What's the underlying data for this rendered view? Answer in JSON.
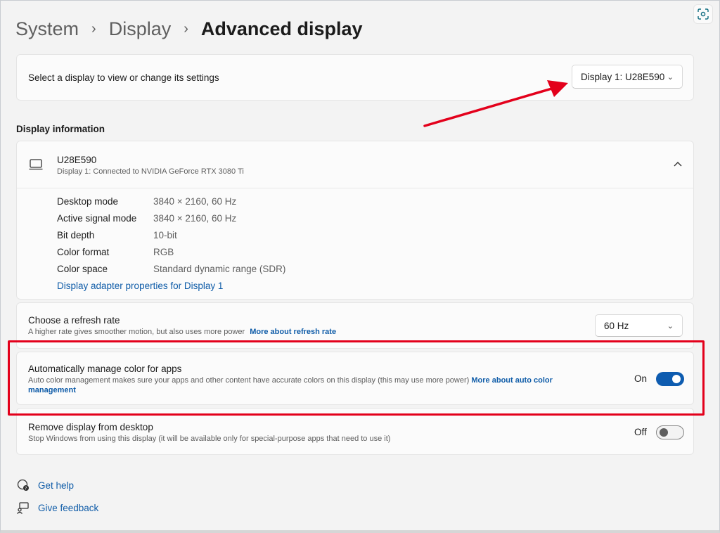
{
  "breadcrumb": {
    "items": [
      "System",
      "Display"
    ],
    "current": "Advanced display",
    "separator": "›"
  },
  "display_select": {
    "label": "Select a display to view or change its settings",
    "value": "Display 1: U28E590"
  },
  "display_information": {
    "section_title": "Display information",
    "monitor_name": "U28E590",
    "monitor_connection": "Display 1: Connected to NVIDIA GeForce RTX 3080 Ti",
    "rows": [
      {
        "key": "Desktop mode",
        "value": "3840 × 2160, 60 Hz"
      },
      {
        "key": "Active signal mode",
        "value": "3840 × 2160, 60 Hz"
      },
      {
        "key": "Bit depth",
        "value": "10-bit"
      },
      {
        "key": "Color format",
        "value": "RGB"
      },
      {
        "key": "Color space",
        "value": "Standard dynamic range (SDR)"
      }
    ],
    "adapter_link": "Display adapter properties for Display 1"
  },
  "refresh_rate": {
    "title": "Choose a refresh rate",
    "description": "A higher rate gives smoother motion, but also uses more power",
    "link": "More about refresh rate",
    "value": "60 Hz"
  },
  "auto_color": {
    "title": "Automatically manage color for apps",
    "description": "Auto color management makes sure your apps and other content have accurate colors on this display (this may use more power)",
    "link_line1": "More about auto color",
    "link_line2": "management",
    "state_label": "On",
    "enabled": true
  },
  "remove_display": {
    "title": "Remove display from desktop",
    "description": "Stop Windows from using this display (it will be available only for special-purpose apps that need to use it)",
    "state_label": "Off",
    "enabled": false
  },
  "footer": {
    "get_help": "Get help",
    "give_feedback": "Give feedback"
  },
  "colors": {
    "accent": "#0e5cb0",
    "link": "#0f5ca8",
    "annotation_red": "#e3001b"
  },
  "icons": [
    "capture-icon",
    "monitor-icon",
    "chevron-up-icon",
    "chevron-down-icon",
    "help-icon",
    "feedback-icon"
  ]
}
